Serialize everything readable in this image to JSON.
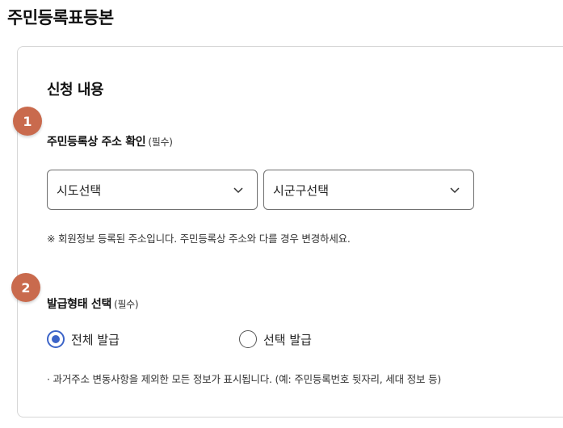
{
  "page": {
    "title": "주민등록표등본"
  },
  "request": {
    "section_title": "신청 내용",
    "step1": {
      "badge": "1",
      "label": "주민등록상 주소 확인",
      "required": "(필수)",
      "sido_select": {
        "value": "시도선택"
      },
      "sigungu_select": {
        "value": "시군구선택"
      },
      "note": "※ 회원정보 등록된 주소입니다. 주민등록상 주소와 다를 경우 변경하세요."
    },
    "step2": {
      "badge": "2",
      "label": "발급형태 선택",
      "required": "(필수)",
      "options": [
        {
          "label": "전체 발급",
          "selected": true
        },
        {
          "label": "선택 발급",
          "selected": false
        }
      ],
      "note": "· 과거주소 변동사항을 제외한 모든 정보가 표시됩니다. (예: 주민등록번호 뒷자리, 세대 정보 등)"
    }
  },
  "colors": {
    "badge": "#c96a4d",
    "radio_selected": "#3c64c8",
    "border": "#d6d6d6"
  },
  "icons": {
    "select_chevron": "chevron-down-icon"
  }
}
